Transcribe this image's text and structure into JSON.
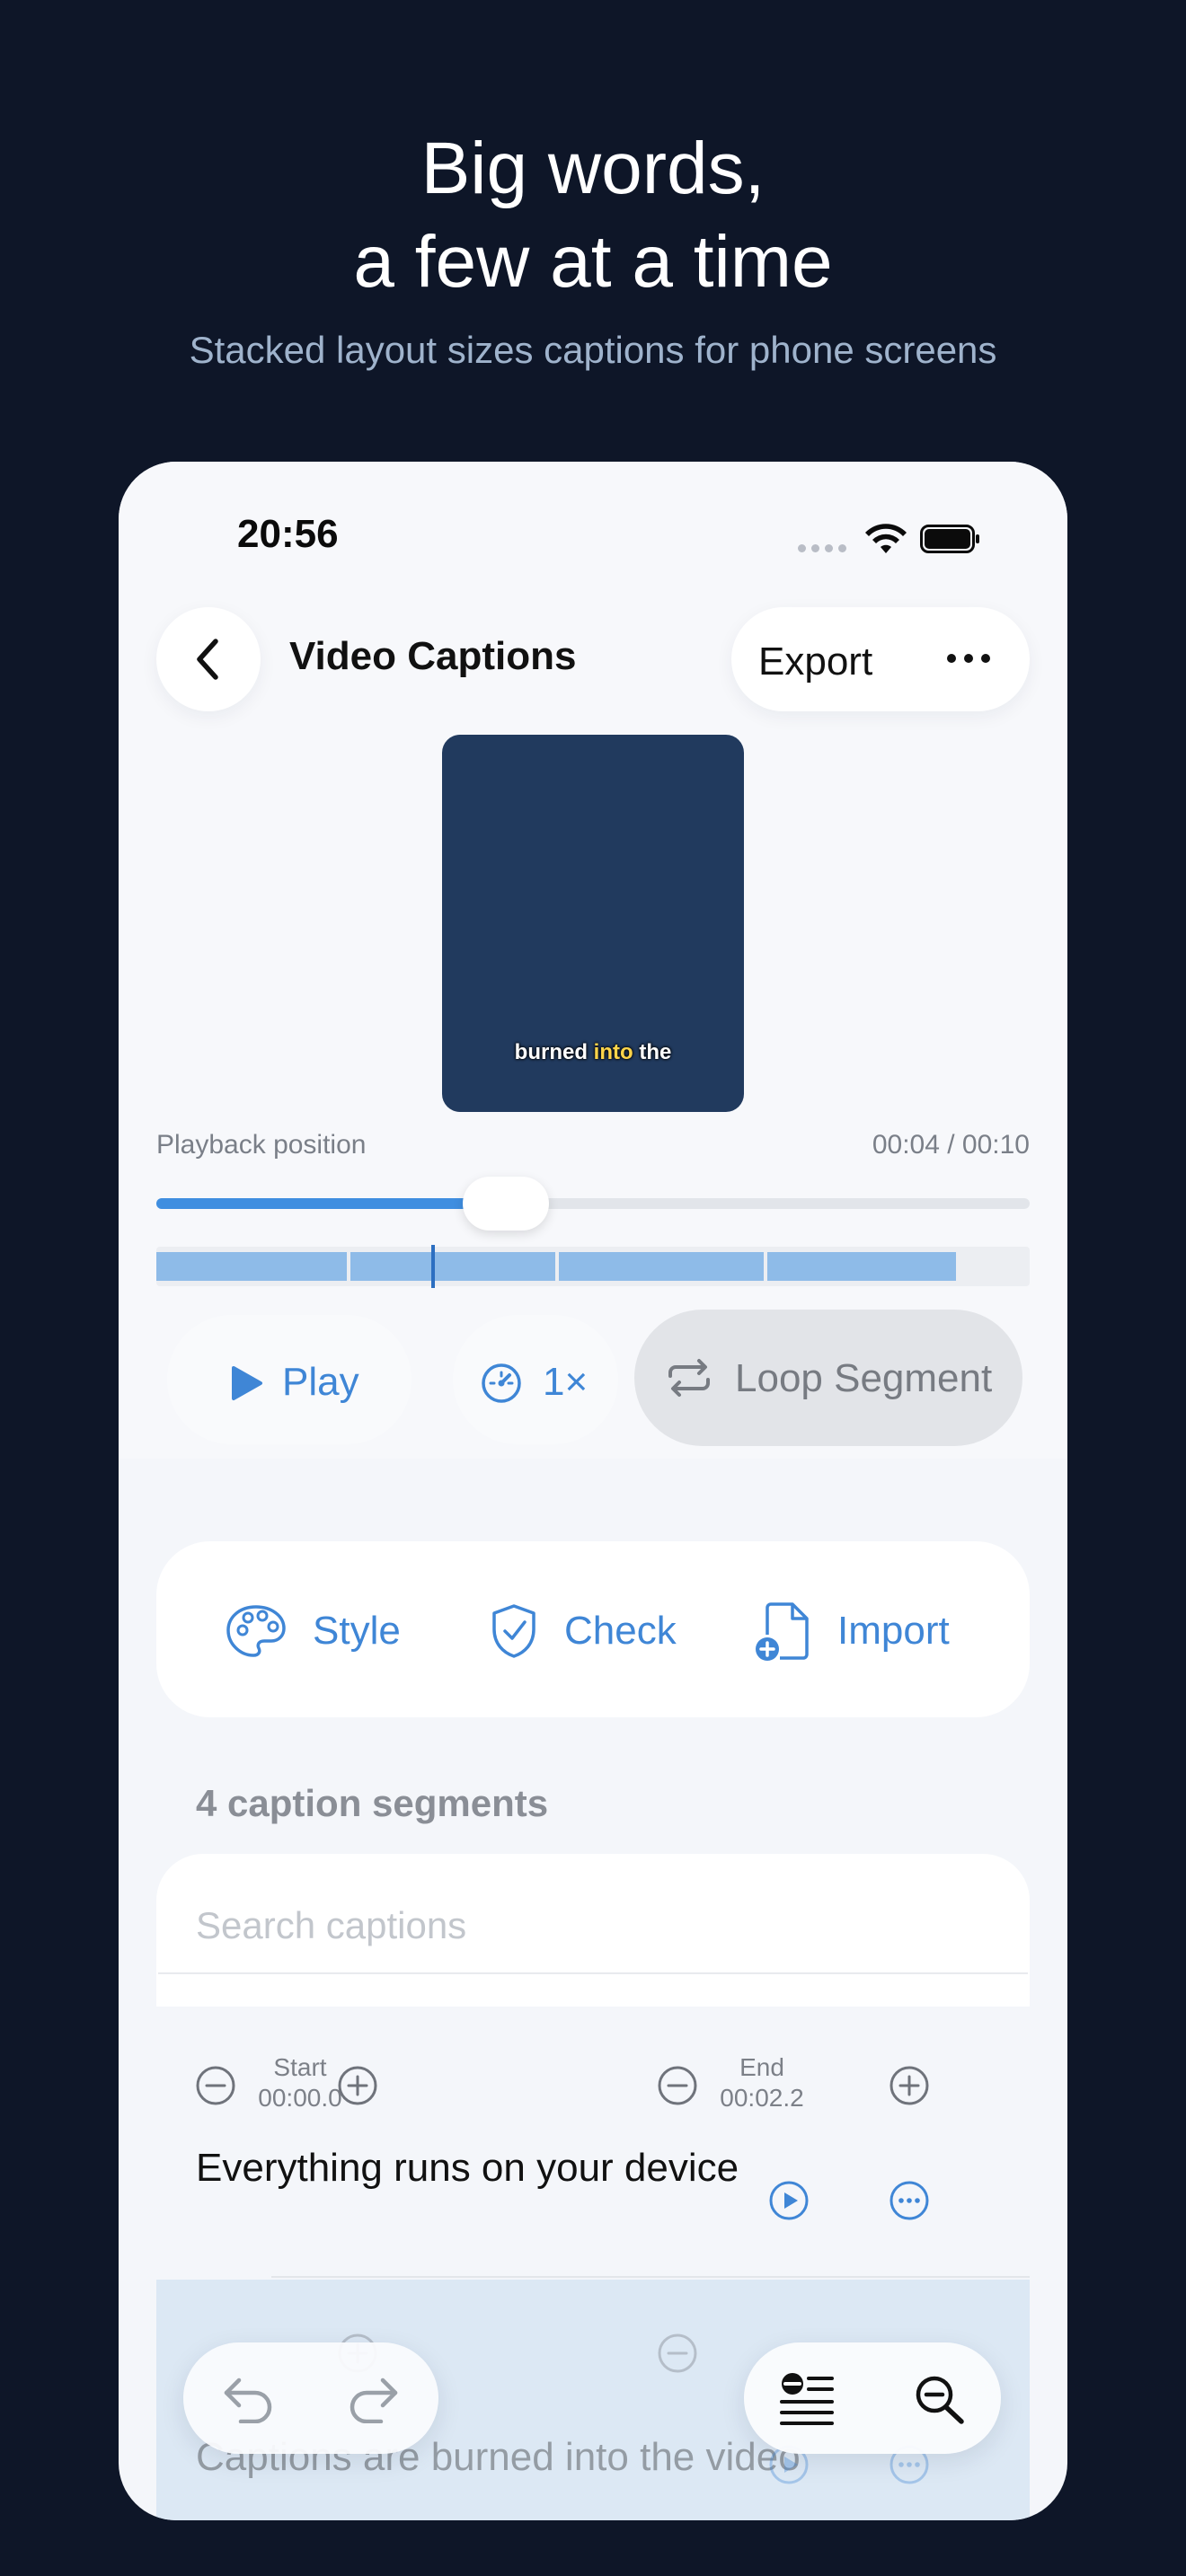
{
  "hero": {
    "title_line1": "Big words,",
    "title_line2": "a few at a time",
    "subtitle": "Stacked layout sizes captions for phone screens"
  },
  "status_bar": {
    "time": "20:56"
  },
  "nav": {
    "title": "Video Captions",
    "export_label": "Export",
    "back_icon": "chevron-left-icon",
    "more_icon": "ellipsis-icon"
  },
  "preview": {
    "caption_before": "burned ",
    "caption_highlight": "into",
    "caption_after": " the",
    "highlight_color": "#ffd54a",
    "background_color": "#213a5e"
  },
  "playback": {
    "label": "Playback position",
    "time_display": "00:04 / 00:10",
    "position_fraction": 0.4
  },
  "controls": {
    "play_label": "Play",
    "speed_label": "1×",
    "loop_label": "Loop Segment"
  },
  "tools": {
    "style_label": "Style",
    "check_label": "Check",
    "import_label": "Import"
  },
  "segments": {
    "count_label": "4 caption segments",
    "search_placeholder": "Search captions",
    "rows": [
      {
        "start_label": "Start",
        "start_value": "00:00.0",
        "end_label": "End",
        "end_value": "00:02.2",
        "text": "Everything runs on your device"
      },
      {
        "text": "Captions are burned into the video"
      }
    ]
  },
  "colors": {
    "accent": "#3f86d6",
    "page_background": "#0e1628"
  }
}
